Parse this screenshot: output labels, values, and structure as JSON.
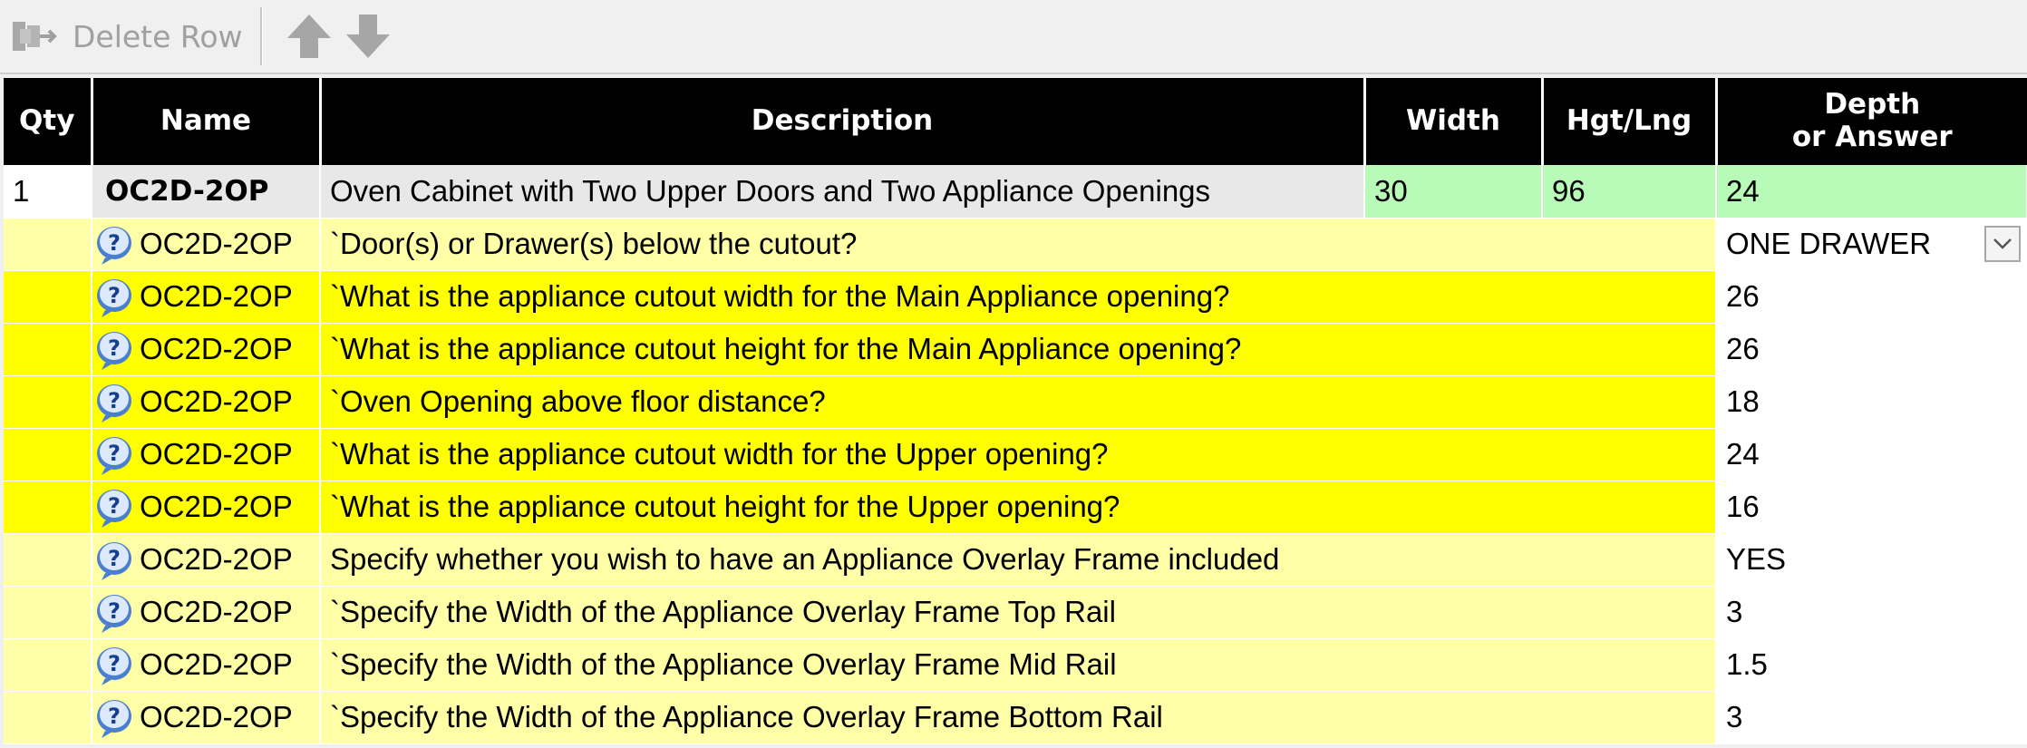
{
  "toolbar": {
    "delete_row_label": "Delete Row",
    "move_up_icon": "arrow-up-icon",
    "move_down_icon": "arrow-down-icon"
  },
  "colors": {
    "header_bg": "#000000",
    "dimension_bg": "#b8fbb8",
    "question_bg": "#ffffa8",
    "highlight_bg": "#ffff00",
    "answer_bg": "#ffffff"
  },
  "grid": {
    "columns": {
      "qty": "Qty",
      "name": "Name",
      "description": "Description",
      "width": "Width",
      "hgt": "Hgt/Lng",
      "depth_line1": "Depth",
      "depth_line2": "or Answer"
    },
    "main_row": {
      "qty": "1",
      "name": "OC2D-2OP",
      "description": "Oven Cabinet with Two Upper Doors and Two Appliance Openings",
      "width": "30",
      "hgt": "96",
      "depth": "24"
    },
    "question_rows": [
      {
        "name": "OC2D-2OP",
        "question": "`Door(s) or Drawer(s) below the cutout?",
        "answer": "ONE DRAWER"
      },
      {
        "name": "OC2D-2OP",
        "question": "`What is the appliance cutout width for the Main Appliance opening?",
        "answer": "26"
      },
      {
        "name": "OC2D-2OP",
        "question": "`What is the appliance cutout height for the Main Appliance opening?",
        "answer": "26"
      },
      {
        "name": "OC2D-2OP",
        "question": "`Oven Opening above floor distance?",
        "answer": "18"
      },
      {
        "name": "OC2D-2OP",
        "question": "`What is the appliance cutout width for the Upper opening?",
        "answer": "24"
      },
      {
        "name": "OC2D-2OP",
        "question": "`What is the appliance cutout height for the Upper opening?",
        "answer": "16"
      },
      {
        "name": "OC2D-2OP",
        "question": "Specify whether you wish to have an Appliance Overlay Frame included",
        "answer": "YES"
      },
      {
        "name": "OC2D-2OP",
        "question": "`Specify the Width of the Appliance Overlay Frame Top Rail",
        "answer": "3"
      },
      {
        "name": "OC2D-2OP",
        "question": "`Specify the Width of the Appliance Overlay Frame Mid Rail",
        "answer": "1.5"
      },
      {
        "name": "OC2D-2OP",
        "question": "`Specify the Width of the Appliance Overlay Frame Bottom Rail",
        "answer": "3"
      }
    ],
    "row_icon": "help-question-icon",
    "dropdown_icon": "chevron-down-icon"
  }
}
